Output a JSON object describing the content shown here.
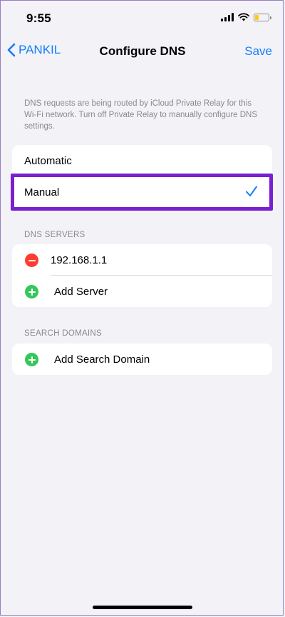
{
  "status": {
    "time": "9:55"
  },
  "nav": {
    "back_label": "PANKIL",
    "title": "Configure DNS",
    "save_label": "Save"
  },
  "info_text": "DNS requests are being routed by iCloud Private Relay for this Wi-Fi network. Turn off Private Relay to manually configure DNS settings.",
  "mode": {
    "options": [
      {
        "label": "Automatic",
        "selected": false
      },
      {
        "label": "Manual",
        "selected": true
      }
    ]
  },
  "dns_servers": {
    "header": "DNS SERVERS",
    "servers": [
      "192.168.1.1"
    ],
    "add_label": "Add Server"
  },
  "search_domains": {
    "header": "SEARCH DOMAINS",
    "add_label": "Add Search Domain"
  },
  "colors": {
    "accent": "#147efb",
    "highlight": "#7a1fd0",
    "delete": "#ff3b30",
    "add": "#34c759",
    "background": "#f2f2f7"
  },
  "icons": {
    "back": "chevron-left-icon",
    "check": "checkmark-icon",
    "delete": "minus-circle-icon",
    "add": "plus-circle-icon"
  }
}
